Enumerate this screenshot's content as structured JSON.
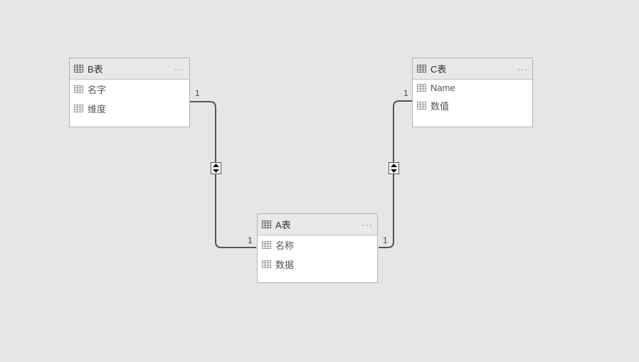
{
  "tables": {
    "b": {
      "title": "B表",
      "fields": [
        "名字",
        "维度"
      ]
    },
    "c": {
      "title": "C表",
      "fields": [
        "Name",
        "数值"
      ]
    },
    "a": {
      "title": "A表",
      "fields": [
        "名称",
        "数据"
      ]
    }
  },
  "relations": {
    "b_a": {
      "from_card": "1",
      "to_card": "1"
    },
    "c_a": {
      "from_card": "1",
      "to_card": "1"
    }
  },
  "ui": {
    "more": "···"
  }
}
